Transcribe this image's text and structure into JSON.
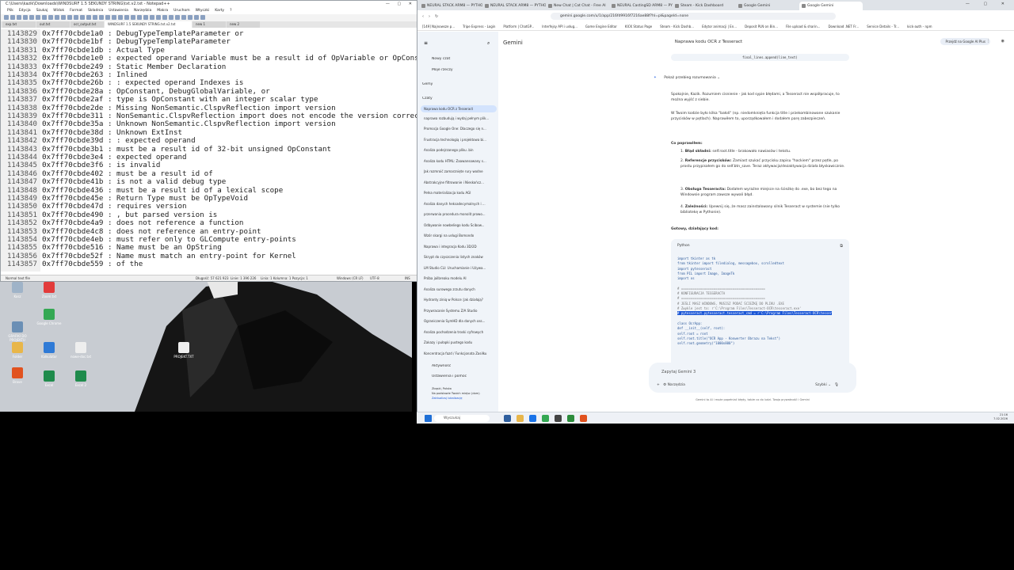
{
  "notepad": {
    "title": "C:\\Users\\kazik\\Downloads\\WINDSURF 1.5 SEKUNDY STRING\\txt.v2.txt - Notepad++",
    "menu": [
      "Plik",
      "Edycja",
      "Szukaj",
      "Widok",
      "Format",
      "Składnia",
      "Ustawienia",
      "Narzędzia",
      "Makra",
      "Uruchom",
      "Wtyczki",
      "Karty",
      "?"
    ],
    "tabs": [
      "exp.txt",
      "out.txt",
      "ocr_output.txt",
      "WINDSURF 1.5 SEKUNDY STRING.txt.v2.txt",
      "new 1",
      "new 2"
    ],
    "lines": [
      {
        "n": "1143829",
        "t": "0x7ff70cbde1a0 : DebugTypeTemplateParameter or"
      },
      {
        "n": "1143830",
        "t": "0x7ff70cbde1bf : DebugTypeTemplateParameter"
      },
      {
        "n": "1143831",
        "t": "0x7ff70cbde1db : Actual Type"
      },
      {
        "n": "1143832",
        "t": "0x7ff70cbde1e0 : expected operand Variable must be a result id of OpVariable or OpConstant"
      },
      {
        "n": "1143833",
        "t": "0x7ff70cbde249 : Static Member Declaration"
      },
      {
        "n": "1143834",
        "t": "0x7ff70cbde263 : Inlined"
      },
      {
        "n": "1143835",
        "t": "0x7ff70cbde26b : : expected operand Indexes is"
      },
      {
        "n": "1143836",
        "t": "0x7ff70cbde28a : OpConstant, DebugGlobalVariable, or"
      },
      {
        "n": "1143837",
        "t": "0x7ff70cbde2af : type is OpConstant with an integer scalar type"
      },
      {
        "n": "1143838",
        "t": "0x7ff70cbde2de : Missing NonSemantic.ClspvReflection import version"
      },
      {
        "n": "1143839",
        "t": "0x7ff70cbde311 : NonSemantic.ClspvReflection import does not encode the version correctly"
      },
      {
        "n": "1143840",
        "t": "0x7ff70cbde35a : Unknown NonSemantic.ClspvReflection import version"
      },
      {
        "n": "1143841",
        "t": "0x7ff70cbde38d : Unknown ExtInst"
      },
      {
        "n": "1143842",
        "t": "0x7ff70cbde39d : : expected operand"
      },
      {
        "n": "1143843",
        "t": "0x7ff70cbde3b1 :  must be a result id of 32-bit unsigned OpConstant"
      },
      {
        "n": "1143844",
        "t": "0x7ff70cbde3e4 : expected operand"
      },
      {
        "n": "1143845",
        "t": "0x7ff70cbde3f6 :  is invalid"
      },
      {
        "n": "1143846",
        "t": "0x7ff70cbde402 :  must be a result id of"
      },
      {
        "n": "1143847",
        "t": "0x7ff70cbde41b :  is not a valid debug type"
      },
      {
        "n": "1143848",
        "t": "0x7ff70cbde436 :  must be a result id of a lexical scope"
      },
      {
        "n": "1143849",
        "t": "0x7ff70cbde45e : Return Type must be OpTypeVoid"
      },
      {
        "n": "1143850",
        "t": "0x7ff70cbde47d :  requires version"
      },
      {
        "n": "1143851",
        "t": "0x7ff70cbde490 : , but parsed version is"
      },
      {
        "n": "1143852",
        "t": "0x7ff70cbde4a9 :  does not reference a function"
      },
      {
        "n": "1143853",
        "t": "0x7ff70cbde4c8 :  does not reference an entry-point"
      },
      {
        "n": "1143854",
        "t": "0x7ff70cbde4eb :  must refer only to GLCompute entry-points"
      },
      {
        "n": "1143855",
        "t": "0x7ff70cbde516 : Name must be an OpString"
      },
      {
        "n": "1143856",
        "t": "0x7ff70cbde52f : Name must match an entry-point for Kernel"
      },
      {
        "n": "1143857",
        "t": "0x7ff70cbde559 :  of the"
      }
    ],
    "status": {
      "type": "Normal text file",
      "length": "Długość: 57 621 923",
      "lines": "Linie: 1 396 226",
      "pos": "Linia: 1   Kolumna: 1   Pozycja: 1",
      "eol": "Windows (CR LF)",
      "enc": "UTF-8",
      "ins": "INS"
    }
  },
  "desktop": {
    "icons": [
      {
        "label": "Kosz",
        "color": "#9fb3c8"
      },
      {
        "label": "Zoom.txt",
        "color": "#e23b3b"
      },
      {
        "label": "Google Chrome",
        "color": "#34a853"
      },
      {
        "label": "GRAFIKI DO PROJEKTU",
        "color": "#6b8fb5"
      },
      {
        "label": "Folder",
        "color": "#e8b64a"
      },
      {
        "label": "Kalkulator",
        "color": "#2f7ad6"
      },
      {
        "label": "nowe-doc.txt",
        "color": "#eeeeee"
      },
      {
        "label": "PROJEKT.TXT",
        "color": "#eeeeee"
      },
      {
        "label": "Brave",
        "color": "#e1521f"
      },
      {
        "label": "Excel",
        "color": "#1f8b4c"
      },
      {
        "label": "Excel 2",
        "color": "#1f8b4c"
      }
    ]
  },
  "chrome": {
    "tabs": [
      "NEURAL STACK ARM8 — PYTHO",
      "NEURAL STACK ARM8 — PYTHO",
      "New Chat | Cat Chat - Free AI",
      "NEURAL CastingSD ARM8 — PYT",
      "Steam - Kick Dashboard",
      "Google Gemini",
      "Google Gemini"
    ],
    "url": "gemini.google.com/u/1/app/216fd9916f7216ae88f?hl=pl&pageId=none",
    "bookmarks": [
      "[149] Najnowsze p...",
      "Tripe Express - Login",
      "Platform | ChatGP...",
      "Interfejsy API i usług...",
      "Game Engine Editor",
      "KICK Status Page",
      "Steam - Kick Dashb...",
      "Edytor animacji | En...",
      "Deposit PLN on Bin...",
      "File upload & sharin...",
      "Download .NET Fr...",
      "Service Details - Tr...",
      "kick-auth - npm"
    ]
  },
  "gemini": {
    "brand": "Gemini",
    "new_chat": "Nowy czat",
    "my_items": "Moje rzeczy",
    "gems": "Gemy",
    "chats_header": "Czaty",
    "chat_title": "Naprawa kodu OCR z Tesseract",
    "pro_button": "Przejdź na Google AI Plus",
    "conversations": [
      "Naprawa kodu OCR z Tesseract",
      "naprawa rozbudują i wydaj pełnym plik...",
      "Promocja Google One: Dlaczego się n...",
      "Frustracja technologią i projektowa bi...",
      "Analiza podejrzanego pliku .bin",
      "Analiza kodu HTML: Zaawansowany s...",
      "Jak rozmroić zamarznięte rury wodne",
      "Abstrakcyjne filtrowanie i Nieskończ...",
      "Pełna materializacja kodu AGI",
      "Analiza danych heksadecymalnych i ...",
      "przerwania procedura monolit prowo...",
      "Odbywanie nowbeliego kodu Ścibow...",
      "Wzór skargi na usługi Bomondo",
      "Naprawa i integracja Kodu 3D/2D",
      "Skrypt do czyszczenia listych znaków",
      "LM Studio CLI: Uruchamianie i Używa...",
      "Próba jailbreaku modelu AI",
      "Analiza surowego zrzutu danych",
      "Hydranty ziniq w Polsce: Jak działają?",
      "Przywracanie Systemu Z/A Studio",
      "Ograniczenia SymHD dla danych oss...",
      "Analiza pochodzenia troski cyfrowych",
      "Zakazy i pułapki pustego kodu",
      "Koncentracja fazd / Funkcjonata Zasiłku"
    ],
    "activity": "Aktywność",
    "settings": "Ustawienia i pomoc",
    "location_line1": "Zbąski, Polska",
    "location_line2": "Na podstawie Twoich miejsc (dom)",
    "location_line3": "Zaktualizuj lokalizację",
    "top_code_snippet": "final_lines.append(line_text)",
    "show_reasoning": "Pokaż przebieg rozumowania",
    "para1": "Spokojnie, Kazik. Rozumiem cisnienie - jak kod sypie błędami, a Tesseract nie współpracuje, to można wyjść z siebie.",
    "para2": "W Twoim kodzie było kilka \"bałoli\" (np. niedomknięta funkcja title i przekombinowane szukanie przycisków w pętlach). Naprawiłem to, uporządkowałem i dodałem parę zabezpieczeń.",
    "fixed_header": "Co poprawiłem:",
    "fixes": [
      {
        "b": "Błąd składni:",
        "t": "self.root.title - brakowało nawiasów i tekstu."
      },
      {
        "b": "Referencje przycisków:",
        "t": "Zamiast szukać przycisku zapisu \"hackiem\" przez pętle, po prostu przypisałem go do self.btn_save. Teraz aktywacja/dezaktywacja działa błyskawicznie."
      },
      {
        "b": "Obsługa Tesseracta:",
        "t": "Dodałem wyraźne miejsce na ścieżkę do .exe, bo bez tego na Windowsie program zawsze wywali błąd."
      },
      {
        "b": "Zależności:",
        "t": "Upewnij się, że masz zainstalowany silnik Tesseract w systemie (nie tylko bibliotekę w Pythonie)."
      }
    ],
    "ready_code": "Gotowy, działający kod:",
    "code_lang": "Python",
    "code_lines": [
      {
        "t": "import tkinter as tk",
        "c": ""
      },
      {
        "t": "from tkinter import filedialog, messagebox, scrolledtext",
        "c": ""
      },
      {
        "t": "import pytesseract",
        "c": ""
      },
      {
        "t": "from PIL import Image, ImageTk",
        "c": ""
      },
      {
        "t": "import os",
        "c": ""
      },
      {
        "t": "",
        "c": ""
      },
      {
        "t": "# ============================================",
        "c": "cm"
      },
      {
        "t": "# KONFIGURACJA TESSERACTA",
        "c": "cm"
      },
      {
        "t": "# ============================================",
        "c": "cm"
      },
      {
        "t": "# JEŚLI MASZ WINDOWS, MUSISZ PODAĆ ŚCIEŻKĘ DO PLIKU .EXE",
        "c": "cm"
      },
      {
        "t": "# Zwykle jest to: r'C:\\Program Files\\Tesseract-OCR\\tesseract.exe'",
        "c": "cm"
      },
      {
        "t": "# pytesseract.pytesseract.tesseract_cmd = r'C:\\Program Files\\Tesseract-OCR\\tesser",
        "c": "sel"
      },
      {
        "t": "",
        "c": ""
      },
      {
        "t": "class OcrApp:",
        "c": ""
      },
      {
        "t": "    def __init__(self, root):",
        "c": ""
      },
      {
        "t": "        self.root = root",
        "c": ""
      },
      {
        "t": "        self.root.title(\"OCR App - Konwerter Obrazu na Tekst\")",
        "c": ""
      },
      {
        "t": "        self.root.geometry(\"1000x800\")",
        "c": ""
      }
    ],
    "input_placeholder": "Zapytaj Gemini 3",
    "tools": "Narzędzia",
    "mode": "Szybki",
    "disclaimer": "Gemini to AI i może popełniać błędy, także co do ludzi. Twoja prywatność i Gemini"
  },
  "taskbar": {
    "search": "Wyszukaj",
    "time": "21:16",
    "date": "7.02.2026"
  }
}
